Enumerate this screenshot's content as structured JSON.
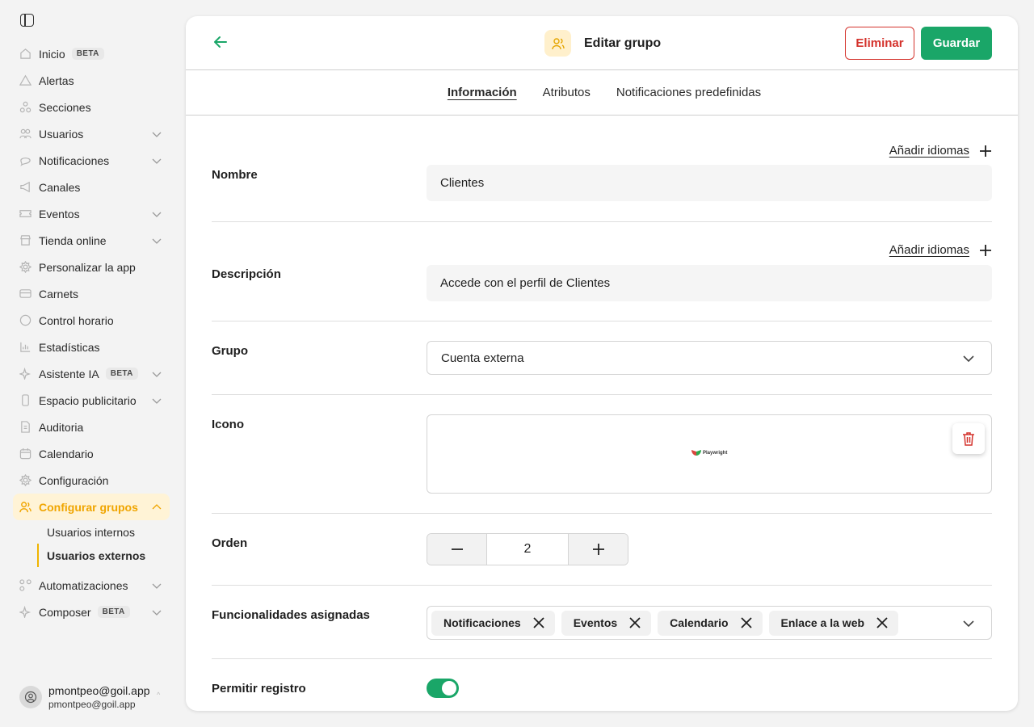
{
  "sidebar": {
    "items": [
      {
        "label": "Inicio",
        "badge": "BETA",
        "icon": "home-icon"
      },
      {
        "label": "Alertas",
        "icon": "alert-icon"
      },
      {
        "label": "Secciones",
        "icon": "sections-icon"
      },
      {
        "label": "Usuarios",
        "icon": "users-icon",
        "expandable": true
      },
      {
        "label": "Notificaciones",
        "icon": "chat-icon",
        "expandable": true
      },
      {
        "label": "Canales",
        "icon": "megaphone-icon"
      },
      {
        "label": "Eventos",
        "icon": "ticket-icon",
        "expandable": true
      },
      {
        "label": "Tienda online",
        "icon": "store-icon",
        "expandable": true
      },
      {
        "label": "Personalizar la app",
        "icon": "gear-icon"
      },
      {
        "label": "Carnets",
        "icon": "card-icon"
      },
      {
        "label": "Control horario",
        "icon": "clock-icon"
      },
      {
        "label": "Estadísticas",
        "icon": "chart-icon"
      },
      {
        "label": "Asistente IA",
        "badge": "BETA",
        "icon": "sparkle-icon",
        "expandable": true
      },
      {
        "label": "Espacio publicitario",
        "icon": "phone-icon",
        "expandable": true
      },
      {
        "label": "Auditoria",
        "icon": "doc-icon"
      },
      {
        "label": "Calendario",
        "icon": "calendar-icon"
      },
      {
        "label": "Configuración",
        "icon": "settings-icon"
      },
      {
        "label": "Configurar grupos",
        "icon": "group-icon",
        "active": true
      }
    ],
    "subitems": [
      {
        "label": "Usuarios internos"
      },
      {
        "label": "Usuarios externos",
        "active": true
      }
    ],
    "items_after": [
      {
        "label": "Automatizaciones",
        "icon": "automation-icon",
        "expandable": true
      },
      {
        "label": "Composer",
        "badge": "BETA",
        "icon": "sparkle-icon",
        "expandable": true
      }
    ],
    "user": {
      "name": "pmontpeo@goil.app",
      "email": "pmontpeo@goil.app"
    }
  },
  "header": {
    "title": "Editar grupo",
    "delete_label": "Eliminar",
    "save_label": "Guardar"
  },
  "tabs": [
    {
      "label": "Información",
      "active": true
    },
    {
      "label": "Atributos"
    },
    {
      "label": "Notificaciones predefinidas"
    }
  ],
  "form": {
    "add_languages": "Añadir idiomas",
    "name": {
      "label": "Nombre",
      "value": "Clientes"
    },
    "description": {
      "label": "Descripción",
      "value": "Accede con el perfil de Clientes"
    },
    "group": {
      "label": "Grupo",
      "value": "Cuenta externa"
    },
    "icon": {
      "label": "Icono",
      "image_text": "Playwright"
    },
    "order": {
      "label": "Orden",
      "value": "2"
    },
    "features": {
      "label": "Funcionalidades asignadas",
      "chips": [
        "Notificaciones",
        "Eventos",
        "Calendario",
        "Enlace a la web"
      ]
    },
    "allow_register": {
      "label": "Permitir registro",
      "on": true
    }
  },
  "colors": {
    "accent": "#1aa668",
    "danger": "#d4322c",
    "active_nav": "#f0a500",
    "active_nav_bg": "#fff3d6"
  }
}
